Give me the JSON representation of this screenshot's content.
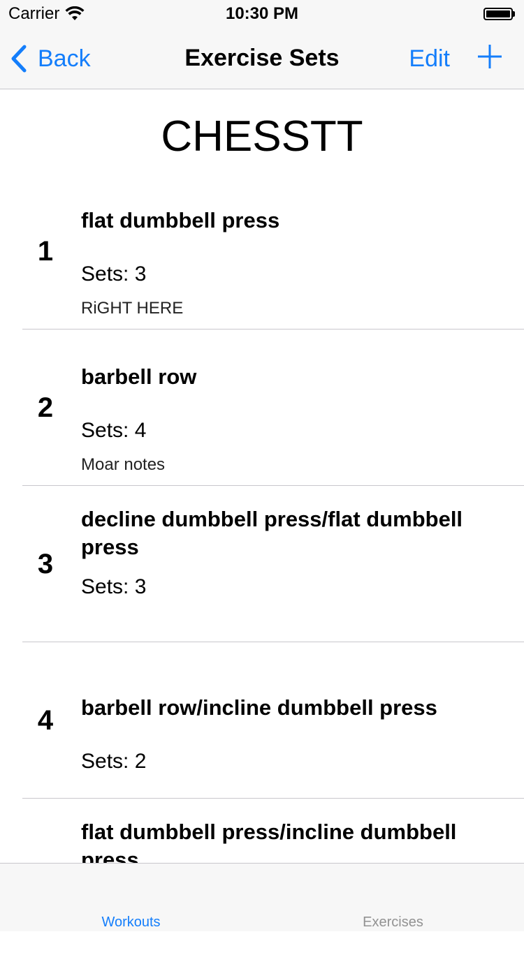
{
  "status_bar": {
    "carrier": "Carrier",
    "time": "10:30 PM",
    "wifi_icon": "wifi-icon",
    "battery_icon": "battery-icon"
  },
  "nav": {
    "back_label": "Back",
    "title": "Exercise Sets",
    "edit_label": "Edit",
    "add_icon": "plus-icon"
  },
  "workout": {
    "title": "CHESSTT"
  },
  "exercises": [
    {
      "index": "1",
      "name": "flat dumbbell press",
      "sets": "Sets: 3",
      "notes": "RiGHT HERE"
    },
    {
      "index": "2",
      "name": "barbell row",
      "sets": "Sets: 4",
      "notes": "Moar notes"
    },
    {
      "index": "3",
      "name": "decline dumbbell press/flat dumbbell press",
      "sets": "Sets: 3",
      "notes": ""
    },
    {
      "index": "4",
      "name": "barbell row/incline dumbbell press",
      "sets": "Sets: 2",
      "notes": ""
    },
    {
      "index": "",
      "name": "flat dumbbell press/incline dumbbell press",
      "sets": "",
      "notes": ""
    }
  ],
  "tab_bar": {
    "tabs": [
      {
        "label": "Workouts",
        "active": true
      },
      {
        "label": "Exercises",
        "active": false
      }
    ]
  },
  "colors": {
    "accent": "#147efb",
    "inactive_tab": "#929292",
    "separator": "#c8c7cc",
    "bar_background": "#f7f7f7"
  }
}
